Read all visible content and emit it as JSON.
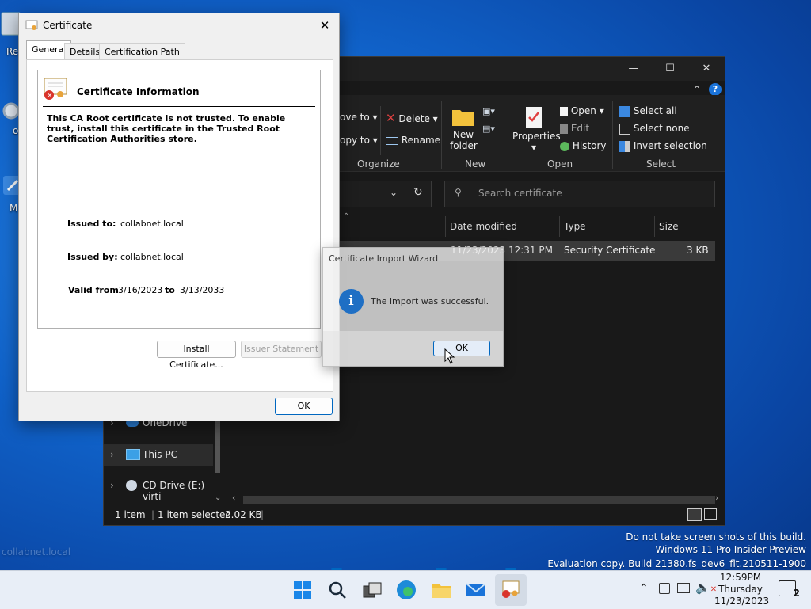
{
  "desktop": {
    "icon_labels": [
      "Re",
      "o",
      "M"
    ],
    "faded_text": "collabnet.local"
  },
  "explorer": {
    "ribbon": {
      "move_to": "ove to",
      "copy_to": "opy to",
      "delete": "Delete",
      "rename": "Rename",
      "new_folder_line1": "New",
      "new_folder_line2": "folder",
      "properties": "Properties",
      "open": "Open",
      "edit": "Edit",
      "history": "History",
      "select_all": "Select all",
      "select_none": "Select none",
      "invert_selection": "Invert selection",
      "groups": [
        "Organize",
        "New",
        "Open",
        "Select"
      ]
    },
    "search_placeholder": "Search certificate",
    "columns": [
      "Date modified",
      "Type",
      "Size"
    ],
    "file_row": {
      "date": "11/23/2023 12:31 PM",
      "type": "Security Certificate",
      "size": "3 KB"
    },
    "nav": [
      "OneDrive",
      "This PC",
      "CD Drive (E:) virti"
    ],
    "status": {
      "items": "1 item",
      "selected": "1 item selected",
      "size": "2.02 KB"
    }
  },
  "certificate": {
    "window_title": "Certificate",
    "tabs": [
      "General",
      "Details",
      "Certification Path"
    ],
    "heading": "Certificate Information",
    "warning": "This CA Root certificate is not trusted. To enable trust, install this certificate in the Trusted Root Certification Authorities store.",
    "issued_to_label": "Issued to:",
    "issued_to": "collabnet.local",
    "issued_by_label": "Issued by:",
    "issued_by": "collabnet.local",
    "valid_from_label": "Valid from",
    "valid_from": "3/16/2023",
    "to_label": "to",
    "valid_to": "3/13/2033",
    "install_button": "Install Certificate...",
    "issuer_button": "Issuer Statement",
    "ok_button": "OK"
  },
  "wizard": {
    "title": "Certificate Import Wizard",
    "message": "The import was successful.",
    "ok_button": "OK"
  },
  "watermark": {
    "line1": "Do not take screen shots of this build.",
    "line2": "Windows 11 Pro Insider Preview",
    "line3": "Evaluation copy. Build 21380.fs_dev6_flt.210511-1900"
  },
  "tray": {
    "time": "12:59PM",
    "day": "Thursday",
    "date": "11/23/2023",
    "notification_count": "2"
  },
  "colors": {
    "accent": "#0067c0",
    "explorer_bg": "#191919",
    "taskbar_bg": "#e8eef7"
  }
}
